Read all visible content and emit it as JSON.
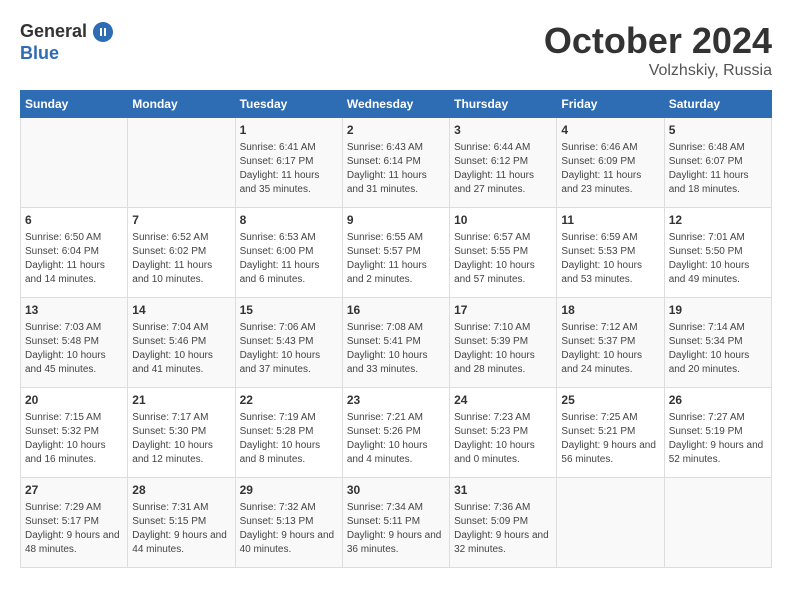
{
  "logo": {
    "general": "General",
    "blue": "Blue"
  },
  "title": {
    "month": "October 2024",
    "location": "Volzhskiy, Russia"
  },
  "weekdays": [
    "Sunday",
    "Monday",
    "Tuesday",
    "Wednesday",
    "Thursday",
    "Friday",
    "Saturday"
  ],
  "weeks": [
    [
      {
        "day": "",
        "info": ""
      },
      {
        "day": "",
        "info": ""
      },
      {
        "day": "1",
        "info": "Sunrise: 6:41 AM\nSunset: 6:17 PM\nDaylight: 11 hours\nand 35 minutes."
      },
      {
        "day": "2",
        "info": "Sunrise: 6:43 AM\nSunset: 6:14 PM\nDaylight: 11 hours\nand 31 minutes."
      },
      {
        "day": "3",
        "info": "Sunrise: 6:44 AM\nSunset: 6:12 PM\nDaylight: 11 hours\nand 27 minutes."
      },
      {
        "day": "4",
        "info": "Sunrise: 6:46 AM\nSunset: 6:09 PM\nDaylight: 11 hours\nand 23 minutes."
      },
      {
        "day": "5",
        "info": "Sunrise: 6:48 AM\nSunset: 6:07 PM\nDaylight: 11 hours\nand 18 minutes."
      }
    ],
    [
      {
        "day": "6",
        "info": "Sunrise: 6:50 AM\nSunset: 6:04 PM\nDaylight: 11 hours\nand 14 minutes."
      },
      {
        "day": "7",
        "info": "Sunrise: 6:52 AM\nSunset: 6:02 PM\nDaylight: 11 hours\nand 10 minutes."
      },
      {
        "day": "8",
        "info": "Sunrise: 6:53 AM\nSunset: 6:00 PM\nDaylight: 11 hours\nand 6 minutes."
      },
      {
        "day": "9",
        "info": "Sunrise: 6:55 AM\nSunset: 5:57 PM\nDaylight: 11 hours\nand 2 minutes."
      },
      {
        "day": "10",
        "info": "Sunrise: 6:57 AM\nSunset: 5:55 PM\nDaylight: 10 hours\nand 57 minutes."
      },
      {
        "day": "11",
        "info": "Sunrise: 6:59 AM\nSunset: 5:53 PM\nDaylight: 10 hours\nand 53 minutes."
      },
      {
        "day": "12",
        "info": "Sunrise: 7:01 AM\nSunset: 5:50 PM\nDaylight: 10 hours\nand 49 minutes."
      }
    ],
    [
      {
        "day": "13",
        "info": "Sunrise: 7:03 AM\nSunset: 5:48 PM\nDaylight: 10 hours\nand 45 minutes."
      },
      {
        "day": "14",
        "info": "Sunrise: 7:04 AM\nSunset: 5:46 PM\nDaylight: 10 hours\nand 41 minutes."
      },
      {
        "day": "15",
        "info": "Sunrise: 7:06 AM\nSunset: 5:43 PM\nDaylight: 10 hours\nand 37 minutes."
      },
      {
        "day": "16",
        "info": "Sunrise: 7:08 AM\nSunset: 5:41 PM\nDaylight: 10 hours\nand 33 minutes."
      },
      {
        "day": "17",
        "info": "Sunrise: 7:10 AM\nSunset: 5:39 PM\nDaylight: 10 hours\nand 28 minutes."
      },
      {
        "day": "18",
        "info": "Sunrise: 7:12 AM\nSunset: 5:37 PM\nDaylight: 10 hours\nand 24 minutes."
      },
      {
        "day": "19",
        "info": "Sunrise: 7:14 AM\nSunset: 5:34 PM\nDaylight: 10 hours\nand 20 minutes."
      }
    ],
    [
      {
        "day": "20",
        "info": "Sunrise: 7:15 AM\nSunset: 5:32 PM\nDaylight: 10 hours\nand 16 minutes."
      },
      {
        "day": "21",
        "info": "Sunrise: 7:17 AM\nSunset: 5:30 PM\nDaylight: 10 hours\nand 12 minutes."
      },
      {
        "day": "22",
        "info": "Sunrise: 7:19 AM\nSunset: 5:28 PM\nDaylight: 10 hours\nand 8 minutes."
      },
      {
        "day": "23",
        "info": "Sunrise: 7:21 AM\nSunset: 5:26 PM\nDaylight: 10 hours\nand 4 minutes."
      },
      {
        "day": "24",
        "info": "Sunrise: 7:23 AM\nSunset: 5:23 PM\nDaylight: 10 hours\nand 0 minutes."
      },
      {
        "day": "25",
        "info": "Sunrise: 7:25 AM\nSunset: 5:21 PM\nDaylight: 9 hours\nand 56 minutes."
      },
      {
        "day": "26",
        "info": "Sunrise: 7:27 AM\nSunset: 5:19 PM\nDaylight: 9 hours\nand 52 minutes."
      }
    ],
    [
      {
        "day": "27",
        "info": "Sunrise: 7:29 AM\nSunset: 5:17 PM\nDaylight: 9 hours\nand 48 minutes."
      },
      {
        "day": "28",
        "info": "Sunrise: 7:31 AM\nSunset: 5:15 PM\nDaylight: 9 hours\nand 44 minutes."
      },
      {
        "day": "29",
        "info": "Sunrise: 7:32 AM\nSunset: 5:13 PM\nDaylight: 9 hours\nand 40 minutes."
      },
      {
        "day": "30",
        "info": "Sunrise: 7:34 AM\nSunset: 5:11 PM\nDaylight: 9 hours\nand 36 minutes."
      },
      {
        "day": "31",
        "info": "Sunrise: 7:36 AM\nSunset: 5:09 PM\nDaylight: 9 hours\nand 32 minutes."
      },
      {
        "day": "",
        "info": ""
      },
      {
        "day": "",
        "info": ""
      }
    ]
  ]
}
